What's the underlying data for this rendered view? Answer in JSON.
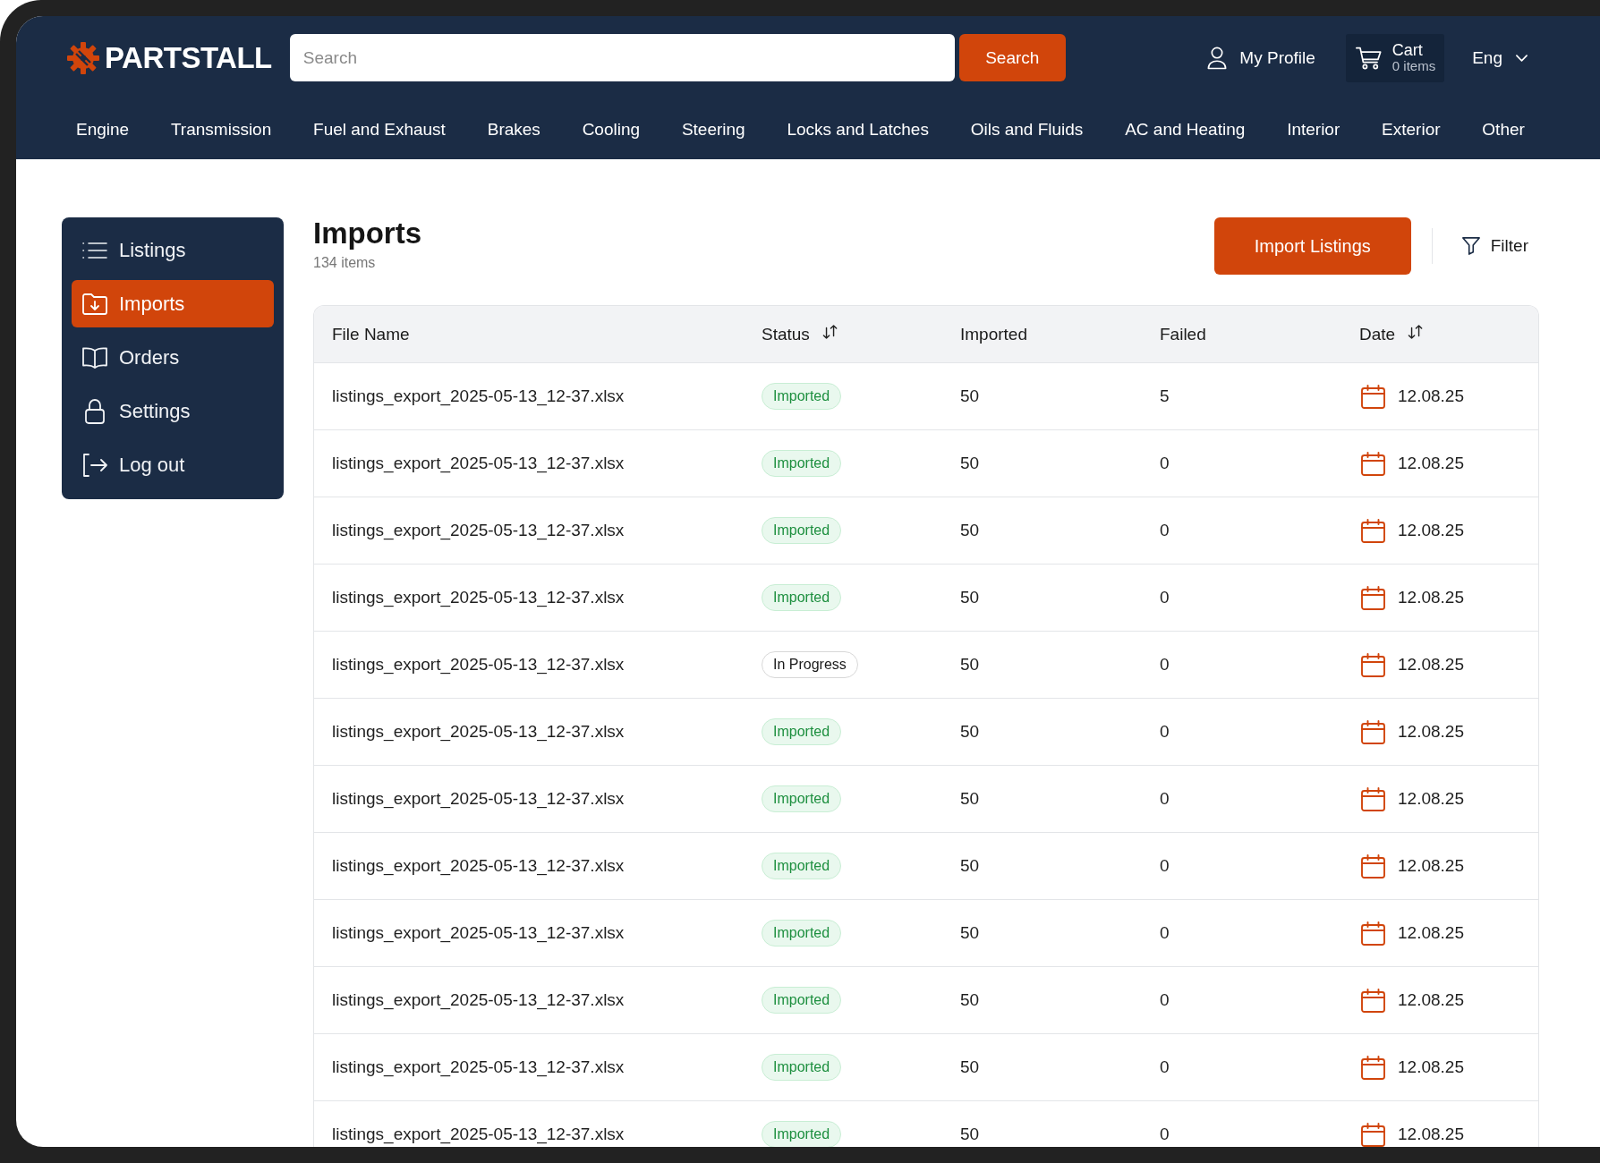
{
  "header": {
    "logo": "PARTSTALL",
    "search": {
      "placeholder": "Search",
      "button": "Search"
    },
    "profile": "My Profile",
    "cart": {
      "label": "Cart",
      "count": "0 items"
    },
    "language": "Eng"
  },
  "categories": [
    "Engine",
    "Transmission",
    "Fuel and Exhaust",
    "Brakes",
    "Cooling",
    "Steering",
    "Locks and Latches",
    "Oils and Fluids",
    "AC and Heating",
    "Interior",
    "Exterior",
    "Other"
  ],
  "sidebar": {
    "items": [
      {
        "label": "Listings",
        "selected": false
      },
      {
        "label": "Imports",
        "selected": true
      },
      {
        "label": "Orders",
        "selected": false
      },
      {
        "label": "Settings",
        "selected": false
      },
      {
        "label": "Log out",
        "selected": false
      }
    ]
  },
  "page": {
    "title": "Imports",
    "count": "134 items",
    "primary_button": "Import Listings",
    "filter_button": "Filter"
  },
  "table": {
    "columns": [
      {
        "label": "File Name",
        "sortable": false
      },
      {
        "label": "Status",
        "sortable": true
      },
      {
        "label": "Imported",
        "sortable": false
      },
      {
        "label": "Failed",
        "sortable": false
      },
      {
        "label": "Date",
        "sortable": true
      }
    ],
    "rows": [
      {
        "file_name": "listings_export_2025-05-13_12-37.xlsx",
        "status": {
          "label": "Imported",
          "kind": "imported"
        },
        "imported": "50",
        "failed": "5",
        "date": "12.08.25"
      },
      {
        "file_name": "listings_export_2025-05-13_12-37.xlsx",
        "status": {
          "label": "Imported",
          "kind": "imported"
        },
        "imported": "50",
        "failed": "0",
        "date": "12.08.25"
      },
      {
        "file_name": "listings_export_2025-05-13_12-37.xlsx",
        "status": {
          "label": "Imported",
          "kind": "imported"
        },
        "imported": "50",
        "failed": "0",
        "date": "12.08.25"
      },
      {
        "file_name": "listings_export_2025-05-13_12-37.xlsx",
        "status": {
          "label": "Imported",
          "kind": "imported"
        },
        "imported": "50",
        "failed": "0",
        "date": "12.08.25"
      },
      {
        "file_name": "listings_export_2025-05-13_12-37.xlsx",
        "status": {
          "label": "In Progress",
          "kind": "in_progress"
        },
        "imported": "50",
        "failed": "0",
        "date": "12.08.25"
      },
      {
        "file_name": "listings_export_2025-05-13_12-37.xlsx",
        "status": {
          "label": "Imported",
          "kind": "imported"
        },
        "imported": "50",
        "failed": "0",
        "date": "12.08.25"
      },
      {
        "file_name": "listings_export_2025-05-13_12-37.xlsx",
        "status": {
          "label": "Imported",
          "kind": "imported"
        },
        "imported": "50",
        "failed": "0",
        "date": "12.08.25"
      },
      {
        "file_name": "listings_export_2025-05-13_12-37.xlsx",
        "status": {
          "label": "Imported",
          "kind": "imported"
        },
        "imported": "50",
        "failed": "0",
        "date": "12.08.25"
      },
      {
        "file_name": "listings_export_2025-05-13_12-37.xlsx",
        "status": {
          "label": "Imported",
          "kind": "imported"
        },
        "imported": "50",
        "failed": "0",
        "date": "12.08.25"
      },
      {
        "file_name": "listings_export_2025-05-13_12-37.xlsx",
        "status": {
          "label": "Imported",
          "kind": "imported"
        },
        "imported": "50",
        "failed": "0",
        "date": "12.08.25"
      },
      {
        "file_name": "listings_export_2025-05-13_12-37.xlsx",
        "status": {
          "label": "Imported",
          "kind": "imported"
        },
        "imported": "50",
        "failed": "0",
        "date": "12.08.25"
      },
      {
        "file_name": "listings_export_2025-05-13_12-37.xlsx",
        "status": {
          "label": "Imported",
          "kind": "imported"
        },
        "imported": "50",
        "failed": "0",
        "date": "12.08.25"
      }
    ]
  }
}
